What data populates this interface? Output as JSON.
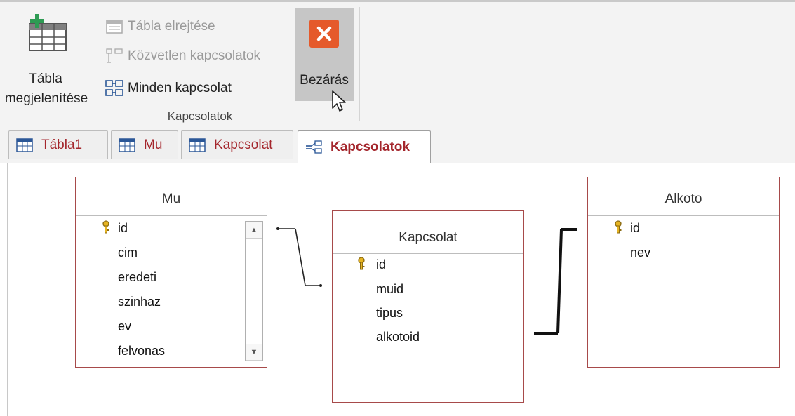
{
  "ribbon": {
    "show_table": {
      "line1": "Tábla",
      "line2": "megjelenítése"
    },
    "hide_table": "Tábla elrejtése",
    "direct_relationships": "Közvetlen kapcsolatok",
    "all_relationships": "Minden kapcsolat",
    "group_label": "Kapcsolatok",
    "close": "Bezárás"
  },
  "tabs": [
    {
      "label": "Tábla1",
      "icon": "table-icon",
      "active": false
    },
    {
      "label": "Mu",
      "icon": "table-icon",
      "active": false
    },
    {
      "label": "Kapcsolat",
      "icon": "table-icon",
      "active": false
    },
    {
      "label": "Kapcsolatok",
      "icon": "relationships-icon",
      "active": true
    }
  ],
  "tables": {
    "mu": {
      "title": "Mu",
      "fields": [
        "id",
        "cim",
        "eredeti",
        "szinhaz",
        "ev",
        "felvonas"
      ],
      "key_field": "id"
    },
    "kapcsolat": {
      "title": "Kapcsolat",
      "fields": [
        "id",
        "muid",
        "tipus",
        "alkotoid"
      ],
      "key_field": "id"
    },
    "alkoto": {
      "title": "Alkoto",
      "fields": [
        "id",
        "nev"
      ],
      "key_field": "id"
    }
  },
  "colors": {
    "table_border": "#a74a4a",
    "tab_text": "#a4262c",
    "close_icon": "#e55a2b",
    "close_button_bg": "#c6c6c6"
  }
}
